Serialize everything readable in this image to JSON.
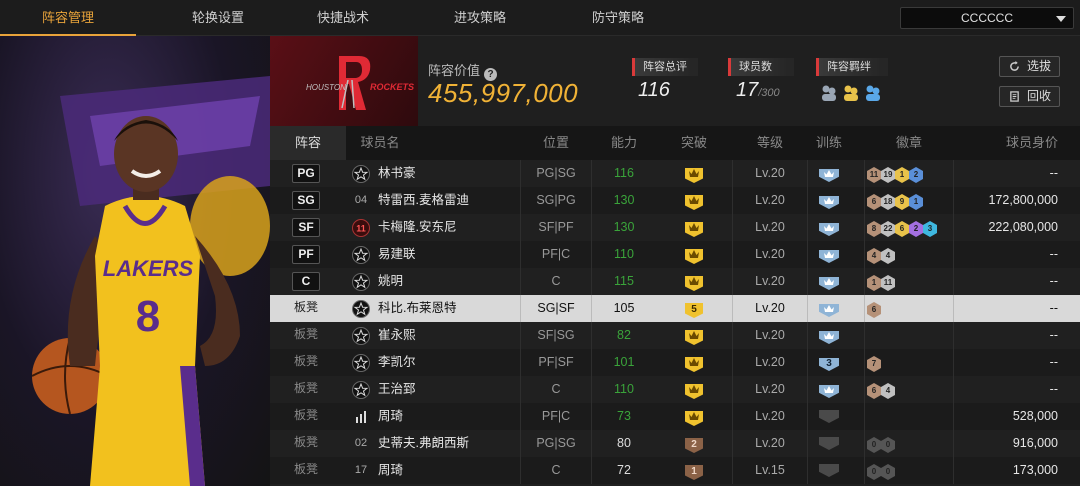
{
  "nav": {
    "tabs": [
      "阵容管理",
      "轮换设置",
      "快捷战术",
      "进攻策略",
      "防守策略"
    ],
    "active_index": 0,
    "dropdown_value": "CCCCCC"
  },
  "team": {
    "value_label": "阵容价值",
    "value": "455,997,000",
    "stats": [
      {
        "label": "阵容总评",
        "value": "116",
        "sub": ""
      },
      {
        "label": "球员数",
        "value": "17",
        "sub": "/300"
      },
      {
        "label": "阵容羁绊",
        "value": "",
        "sub": ""
      }
    ],
    "buttons": [
      "选拔",
      "回收"
    ],
    "colors": {
      "accent": "#f0b236",
      "team_red": "#5a0f16",
      "stat_bar": "#d93a3a"
    }
  },
  "table": {
    "headers": [
      "阵容",
      "球员名",
      "位置",
      "能力",
      "突破",
      "等级",
      "训练",
      "徽章",
      "球员身价"
    ],
    "rows": [
      {
        "role": "PG",
        "icon": "star",
        "num": "",
        "name": "林书豪",
        "pos": "PG|SG",
        "power": "116",
        "power_color": "green",
        "breakthrough": "crown",
        "level": "Lv.20",
        "training": "crown",
        "badges": [
          {
            "n": "11",
            "c": "#b59178"
          },
          {
            "n": "19",
            "c": "#c0c0c0"
          },
          {
            "n": "1",
            "c": "#e8c24a"
          },
          {
            "n": "2",
            "c": "#5a8fd8"
          }
        ],
        "value": "--"
      },
      {
        "role": "SG",
        "icon": "num",
        "num": "04",
        "name": "特雷西.麦格雷迪",
        "pos": "SG|PG",
        "power": "130",
        "power_color": "green",
        "breakthrough": "crown",
        "level": "Lv.20",
        "training": "crown",
        "badges": [
          {
            "n": "6",
            "c": "#b59178"
          },
          {
            "n": "18",
            "c": "#c0c0c0"
          },
          {
            "n": "9",
            "c": "#e8c24a"
          },
          {
            "n": "1",
            "c": "#5a8fd8"
          }
        ],
        "value": "172,800,000"
      },
      {
        "role": "SF",
        "icon": "eleven",
        "num": "11",
        "name": "卡梅隆.安东尼",
        "pos": "SF|PF",
        "power": "130",
        "power_color": "green",
        "breakthrough": "crown",
        "level": "Lv.20",
        "training": "crown",
        "badges": [
          {
            "n": "8",
            "c": "#b59178"
          },
          {
            "n": "22",
            "c": "#c0c0c0"
          },
          {
            "n": "6",
            "c": "#e8c24a"
          },
          {
            "n": "2",
            "c": "#a36fe0"
          },
          {
            "n": "3",
            "c": "#3fb8e0"
          }
        ],
        "value": "222,080,000"
      },
      {
        "role": "PF",
        "icon": "star",
        "num": "",
        "name": "易建联",
        "pos": "PF|C",
        "power": "110",
        "power_color": "green",
        "breakthrough": "crown",
        "level": "Lv.20",
        "training": "crown",
        "badges": [
          {
            "n": "4",
            "c": "#b59178"
          },
          {
            "n": "4",
            "c": "#c0c0c0"
          }
        ],
        "value": "--"
      },
      {
        "role": "C",
        "icon": "star",
        "num": "",
        "name": "姚明",
        "pos": "C",
        "power": "115",
        "power_color": "green",
        "breakthrough": "crown",
        "level": "Lv.20",
        "training": "crown",
        "badges": [
          {
            "n": "1",
            "c": "#b59178"
          },
          {
            "n": "11",
            "c": "#c0c0c0"
          }
        ],
        "value": "--"
      },
      {
        "role": "板凳",
        "icon": "star",
        "num": "",
        "name": "科比.布莱恩特",
        "pos": "SG|SF",
        "power": "105",
        "power_color": "white",
        "breakthrough": "5",
        "level": "Lv.20",
        "training": "crown",
        "badges": [
          {
            "n": "6",
            "c": "#b59178"
          }
        ],
        "value": "--",
        "selected": true
      },
      {
        "role": "板凳",
        "icon": "star",
        "num": "",
        "name": "崔永熙",
        "pos": "SF|SG",
        "power": "82",
        "power_color": "green",
        "breakthrough": "crown",
        "level": "Lv.20",
        "training": "crown",
        "badges": [],
        "value": "--"
      },
      {
        "role": "板凳",
        "icon": "star",
        "num": "",
        "name": "李凯尔",
        "pos": "PF|SF",
        "power": "101",
        "power_color": "green",
        "breakthrough": "crown",
        "level": "Lv.20",
        "training": "3",
        "badges": [
          {
            "n": "7",
            "c": "#b59178"
          }
        ],
        "value": "--"
      },
      {
        "role": "板凳",
        "icon": "star",
        "num": "",
        "name": "王治郅",
        "pos": "C",
        "power": "110",
        "power_color": "green",
        "breakthrough": "crown",
        "level": "Lv.20",
        "training": "crown",
        "badges": [
          {
            "n": "6",
            "c": "#b59178"
          },
          {
            "n": "4",
            "c": "#c0c0c0"
          }
        ],
        "value": "--"
      },
      {
        "role": "板凳",
        "icon": "bars",
        "num": "",
        "name": "周琦",
        "pos": "PF|C",
        "power": "73",
        "power_color": "green",
        "breakthrough": "crown",
        "level": "Lv.20",
        "training": "dim",
        "badges": [],
        "value": "528,000"
      },
      {
        "role": "板凳",
        "icon": "num",
        "num": "02",
        "name": "史蒂夫.弗朗西斯",
        "pos": "PG|SG",
        "power": "80",
        "power_color": "white",
        "breakthrough": "2",
        "level": "Lv.20",
        "training": "dim",
        "badges": [
          {
            "n": "0",
            "c": "#555"
          },
          {
            "n": "0",
            "c": "#555"
          }
        ],
        "value": "916,000"
      },
      {
        "role": "板凳",
        "icon": "num",
        "num": "17",
        "name": "周琦",
        "pos": "C",
        "power": "72",
        "power_color": "white",
        "breakthrough": "1",
        "level": "Lv.15",
        "training": "dim",
        "badges": [
          {
            "n": "0",
            "c": "#555"
          },
          {
            "n": "0",
            "c": "#555"
          }
        ],
        "value": "173,000"
      }
    ]
  }
}
